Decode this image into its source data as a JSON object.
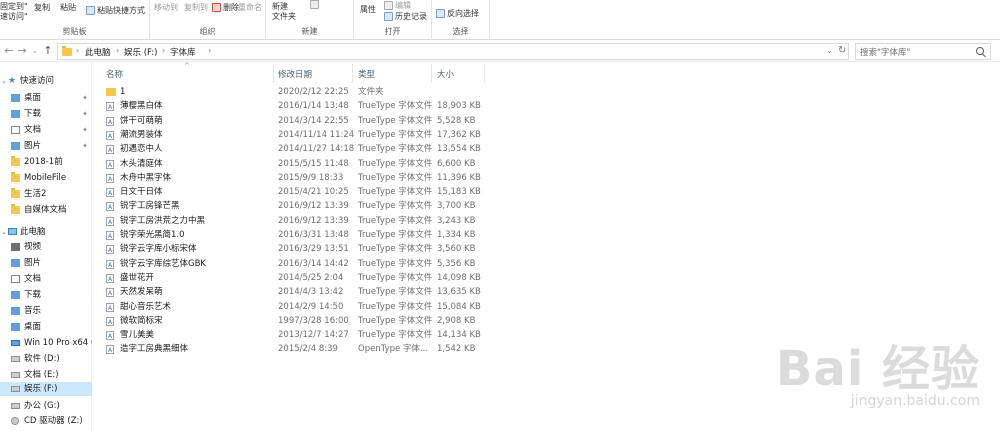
{
  "ribbon": {
    "pin_label": "固定到\"",
    "quick_access_label": "速访问\"",
    "copy": "复制",
    "paste": "粘贴",
    "paste_shortcut": "粘贴快捷方式",
    "clipboard_group": "剪贴板",
    "move_to": "移动到",
    "copy_to": "复制到",
    "delete": "删除",
    "rename": "重命名",
    "organize_group": "组织",
    "new_folder_line1": "新建",
    "new_folder_line2": "文件夹",
    "new_group": "新建",
    "properties": "属性",
    "edit": "编辑",
    "history": "历史记录",
    "open_group": "打开",
    "invert_selection": "反向选择",
    "select_group": "选择"
  },
  "address": {
    "crumbs": [
      "此电脑",
      "娱乐 (F:)",
      "字体库"
    ],
    "search_placeholder": "搜索\"字体库\""
  },
  "nav": {
    "quick_access": "快速访问",
    "items": [
      {
        "label": "桌面",
        "pinned": true
      },
      {
        "label": "下载",
        "pinned": true
      },
      {
        "label": "文档",
        "pinned": true
      },
      {
        "label": "图片",
        "pinned": true
      },
      {
        "label": "2018-1前"
      },
      {
        "label": "MobileFile"
      },
      {
        "label": "生活2"
      },
      {
        "label": "自媒体文档"
      }
    ],
    "this_pc": "此电脑",
    "pc_items": [
      "视频",
      "图片",
      "文档",
      "下载",
      "音乐",
      "桌面"
    ],
    "drives": [
      "Win 10 Pro x64 (C:",
      "软件 (D:)",
      "文档 (E:)",
      "娱乐 (F:)",
      "办公 (G:)",
      "CD 驱动器 (Z:)"
    ],
    "selected_drive_index": 3
  },
  "columns": {
    "name": "名称",
    "date": "修改日期",
    "type": "类型",
    "size": "大小"
  },
  "files": [
    {
      "name": "1",
      "date": "2020/2/12 22:25",
      "type": "文件夹",
      "size": "",
      "folder": true
    },
    {
      "name": "薄樱黑白体",
      "date": "2016/1/14 13:48",
      "type": "TrueType 字体文件",
      "size": "18,903 KB"
    },
    {
      "name": "饼干可萌萌",
      "date": "2014/3/14 22:55",
      "type": "TrueType 字体文件",
      "size": "5,528 KB"
    },
    {
      "name": "潮流男装体",
      "date": "2014/11/14 11:24",
      "type": "TrueType 字体文件",
      "size": "17,362 KB"
    },
    {
      "name": "初遇恋中人",
      "date": "2014/11/27 14:18",
      "type": "TrueType 字体文件",
      "size": "13,554 KB"
    },
    {
      "name": "木头清庭体",
      "date": "2015/5/15 11:48",
      "type": "TrueType 字体文件",
      "size": "6,600 KB"
    },
    {
      "name": "木舟中黑字体",
      "date": "2015/9/9 18:33",
      "type": "TrueType 字体文件",
      "size": "11,396 KB"
    },
    {
      "name": "日文干日体",
      "date": "2015/4/21 10:25",
      "type": "TrueType 字体文件",
      "size": "15,183 KB"
    },
    {
      "name": "锐字工房锋芒黑",
      "date": "2016/9/12 13:39",
      "type": "TrueType 字体文件",
      "size": "3,700 KB"
    },
    {
      "name": "锐字工房洪荒之力中黑",
      "date": "2016/9/12 13:39",
      "type": "TrueType 字体文件",
      "size": "3,243 KB"
    },
    {
      "name": "锐字荣光黑简1.0",
      "date": "2016/3/31 13:48",
      "type": "TrueType 字体文件",
      "size": "1,334 KB"
    },
    {
      "name": "锐字云字库小标宋体",
      "date": "2016/3/29 13:51",
      "type": "TrueType 字体文件",
      "size": "3,560 KB"
    },
    {
      "name": "锐字云字库综艺体GBK",
      "date": "2016/3/14 14:42",
      "type": "TrueType 字体文件",
      "size": "5,356 KB"
    },
    {
      "name": "盛世花开",
      "date": "2014/5/25 2:04",
      "type": "TrueType 字体文件",
      "size": "14,098 KB"
    },
    {
      "name": "天然发呆萌",
      "date": "2014/4/3 13:42",
      "type": "TrueType 字体文件",
      "size": "13,635 KB"
    },
    {
      "name": "甜心音乐艺术",
      "date": "2014/2/9 14:50",
      "type": "TrueType 字体文件",
      "size": "15,084 KB"
    },
    {
      "name": "微软简标宋",
      "date": "1997/3/28 16:00",
      "type": "TrueType 字体文件",
      "size": "2,908 KB"
    },
    {
      "name": "雪儿美美",
      "date": "2013/12/7 14:27",
      "type": "TrueType 字体文件",
      "size": "14,134 KB"
    },
    {
      "name": "造字工房典黑细体",
      "date": "2015/2/4 8:39",
      "type": "OpenType 字体...",
      "size": "1,542 KB"
    }
  ],
  "watermark": {
    "logo": "Bai 经验",
    "url": "jingyan.baidu.com"
  }
}
